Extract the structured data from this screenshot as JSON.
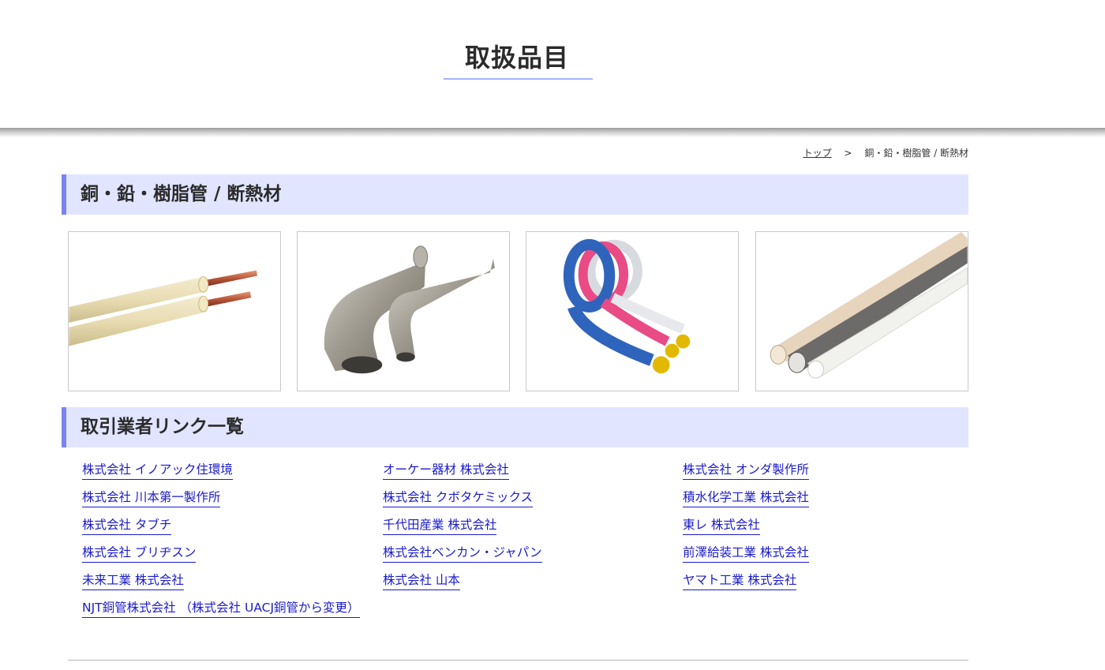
{
  "header": {
    "title": "取扱品目"
  },
  "breadcrumb": {
    "home": "トップ",
    "separator": ">",
    "current": "銅・鉛・樹脂管 / 断熱材"
  },
  "sections": {
    "products": "銅・鉛・樹脂管 / 断熱材",
    "links": "取引業者リンク一覧"
  },
  "links": [
    "株式会社 イノアック住環境",
    "オーケー器材 株式会社",
    "株式会社 オンダ製作所",
    "株式会社 川本第一製作所",
    "株式会社 クボタケミックス",
    "積水化学工業 株式会社",
    "株式会社 タブチ",
    "千代田産業 株式会社",
    "東レ 株式会社",
    "株式会社 ブリヂスン",
    "株式会社ベンカン・ジャパン",
    "前澤給装工業 株式会社",
    "未来工業 株式会社",
    "株式会社 山本",
    "ヤマト工業 株式会社",
    "NJT銅管株式会社 （株式会社 UACJ銅管から変更）"
  ],
  "colors": {
    "accent": "#7a83f0",
    "heading_bg": "#e1e5ff",
    "link": "#1a1acc",
    "title_underline": "#a7b2ff"
  }
}
